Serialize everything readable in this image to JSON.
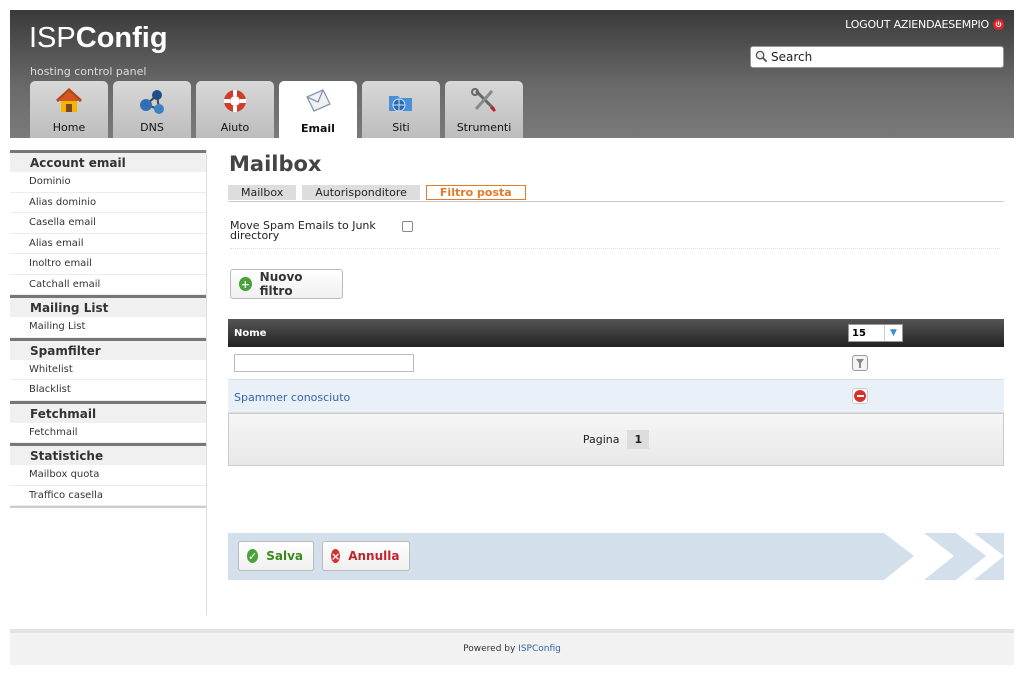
{
  "header": {
    "logo_light": "ISP",
    "logo_bold": "Config",
    "tagline": "hosting control panel",
    "logout_label": "LOGOUT AZIENDAESEMPIO",
    "search_placeholder": "Search"
  },
  "tabs": [
    {
      "label": "Home",
      "icon": "home-icon"
    },
    {
      "label": "DNS",
      "icon": "dns-network-icon"
    },
    {
      "label": "Aiuto",
      "icon": "lifebuoy-icon"
    },
    {
      "label": "Email",
      "icon": "envelope-icon",
      "active": true
    },
    {
      "label": "Siti",
      "icon": "folder-globe-icon"
    },
    {
      "label": "Strumenti",
      "icon": "tools-icon"
    }
  ],
  "sidebar": {
    "sections": [
      {
        "title": "Account email",
        "items": [
          "Dominio",
          "Alias dominio",
          "Casella email",
          "Alias email",
          "Inoltro email",
          "Catchall email"
        ]
      },
      {
        "title": "Mailing List",
        "items": [
          "Mailing List"
        ]
      },
      {
        "title": "Spamfilter",
        "items": [
          "Whitelist",
          "Blacklist"
        ]
      },
      {
        "title": "Fetchmail",
        "items": [
          "Fetchmail"
        ]
      },
      {
        "title": "Statistiche",
        "items": [
          "Mailbox quota",
          "Traffico casella"
        ]
      }
    ]
  },
  "main": {
    "title": "Mailbox",
    "subtabs": [
      "Mailbox",
      "Autorisponditore",
      "Filtro posta"
    ],
    "active_subtab": "Filtro posta",
    "spam_label": "Move Spam Emails to Junk directory",
    "new_filter_label": "Nuovo filtro",
    "table": {
      "col_name": "Nome",
      "per_page": "15",
      "rows": [
        "Spammer conosciuto"
      ],
      "pager_label": "Pagina",
      "page": "1"
    },
    "save_label": "Salva",
    "cancel_label": "Annulla"
  },
  "footer": {
    "prefix": "Powered by ",
    "brand": "ISPConfig"
  },
  "colors": {
    "accent_orange": "#e27b2a",
    "link_blue": "#3366a8",
    "save_green": "#3a8a1c",
    "cancel_red": "#c0262b"
  }
}
